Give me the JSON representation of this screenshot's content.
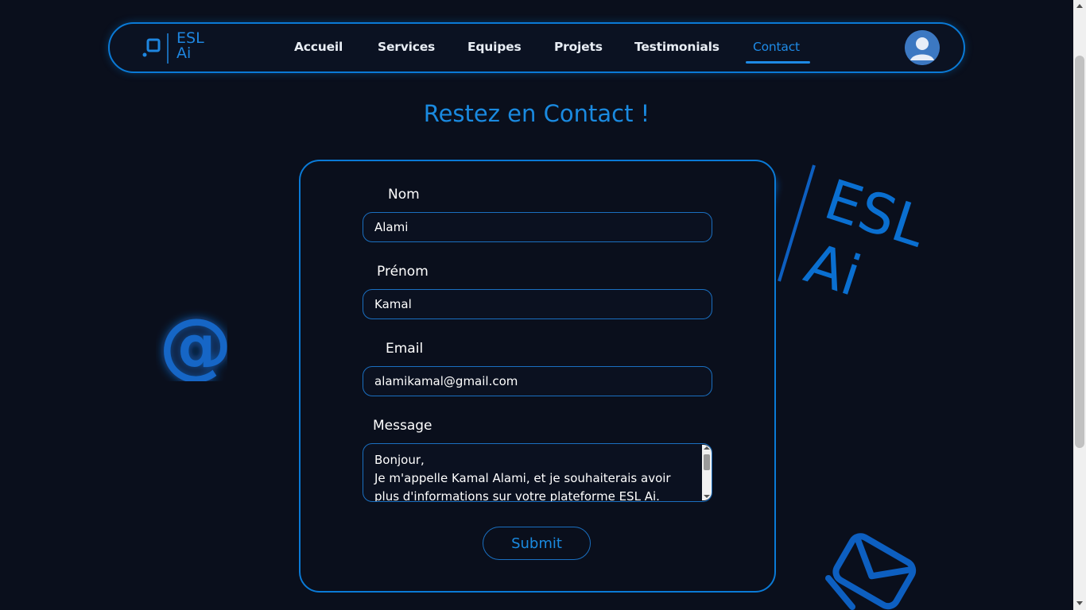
{
  "brand": {
    "line1": "ESL",
    "line2": "Ai"
  },
  "nav": {
    "items": [
      {
        "label": "Accueil"
      },
      {
        "label": "Services"
      },
      {
        "label": "Equipes"
      },
      {
        "label": "Projets"
      },
      {
        "label": "Testimonials"
      },
      {
        "label": "Contact",
        "active": true
      }
    ]
  },
  "main": {
    "title": "Restez en Contact !"
  },
  "form": {
    "nom": {
      "label": "Nom",
      "value": "Alami"
    },
    "prenom": {
      "label": "Prénom",
      "value": "Kamal"
    },
    "email": {
      "label": "Email",
      "value": "alamikamal@gmail.com"
    },
    "message": {
      "label": "Message",
      "value": "Bonjour,\nJe m'appelle Kamal Alami, et je souhaiterais avoir plus d'informations sur votre plateforme ESL Ai."
    },
    "submit_label": "Submit"
  },
  "decorations": {
    "logo_line1": "ESL",
    "logo_line2": "Ai",
    "at_symbol": "@"
  },
  "icons": [
    "logo-square-icon",
    "user-avatar-icon",
    "at-sign-icon",
    "envelope-icon"
  ],
  "colors": {
    "accent": "#1a8ae0",
    "background": "#0a0f1c",
    "border": "#0a7ad6"
  }
}
